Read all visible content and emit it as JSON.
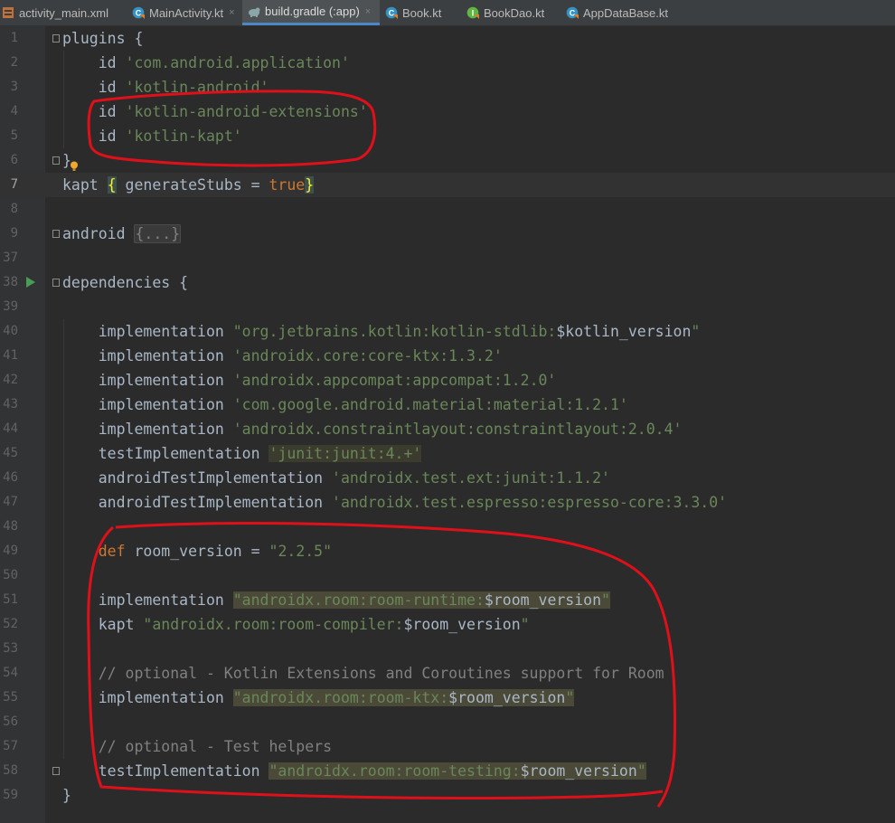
{
  "tabs": [
    {
      "label": "activity_main.xml",
      "icon": "xml-layout-icon",
      "active": false,
      "closable": false
    },
    {
      "label": "MainActivity.kt",
      "icon": "kotlin-class-icon",
      "active": false,
      "closable": true
    },
    {
      "label": "build.gradle (:app)",
      "icon": "gradle-elephant-icon",
      "active": true,
      "closable": true
    },
    {
      "label": "Book.kt",
      "icon": "kotlin-class-icon",
      "active": false,
      "closable": false
    },
    {
      "label": "BookDao.kt",
      "icon": "kotlin-interface-icon",
      "active": false,
      "closable": false
    },
    {
      "label": "AppDataBase.kt",
      "icon": "kotlin-class-icon",
      "active": false,
      "closable": false
    }
  ],
  "close_glyph": "×",
  "colors": {
    "background": "#2b2b2b",
    "keyword": "#cc7832",
    "string": "#6a8759",
    "comment": "#808080",
    "annotation_red": "#e0101a",
    "active_tab_underline": "#4a88c7"
  },
  "current_line": "7",
  "lines": [
    {
      "n": "1",
      "code": [
        {
          "t": "plugins {"
        }
      ]
    },
    {
      "n": "2",
      "code": [
        {
          "t": "    id "
        },
        {
          "t": "'com.android.application'",
          "c": "str"
        }
      ]
    },
    {
      "n": "3",
      "code": [
        {
          "t": "    id "
        },
        {
          "t": "'kotlin-android'",
          "c": "str"
        }
      ]
    },
    {
      "n": "4",
      "code": [
        {
          "t": "    id "
        },
        {
          "t": "'kotlin-android-extensions'",
          "c": "str"
        }
      ]
    },
    {
      "n": "5",
      "code": [
        {
          "t": "    id "
        },
        {
          "t": "'kotlin-kapt'",
          "c": "str"
        }
      ]
    },
    {
      "n": "6",
      "code": [
        {
          "t": "}"
        }
      ]
    },
    {
      "n": "7",
      "code": [
        {
          "t": "kapt "
        },
        {
          "t": "{",
          "c": "brace-match"
        },
        {
          "t": " generateStubs = "
        },
        {
          "t": "true",
          "c": "lit"
        },
        {
          "t": "}",
          "c": "brace-match"
        }
      ]
    },
    {
      "n": "8",
      "code": []
    },
    {
      "n": "9",
      "code": [
        {
          "t": "android "
        },
        {
          "t": "{...}",
          "c": "fold-region"
        }
      ]
    },
    {
      "n": "37",
      "code": []
    },
    {
      "n": "38",
      "code": [
        {
          "t": "dependencies {"
        }
      ]
    },
    {
      "n": "39",
      "code": []
    },
    {
      "n": "40",
      "code": [
        {
          "t": "    implementation "
        },
        {
          "t": "\"org.jetbrains.kotlin:kotlin-stdlib:",
          "c": "str"
        },
        {
          "t": "$kotlin_version"
        },
        {
          "t": "\"",
          "c": "str"
        }
      ]
    },
    {
      "n": "41",
      "code": [
        {
          "t": "    implementation "
        },
        {
          "t": "'androidx.core:core-ktx:1.3.2'",
          "c": "str"
        }
      ]
    },
    {
      "n": "42",
      "code": [
        {
          "t": "    implementation "
        },
        {
          "t": "'androidx.appcompat:appcompat:1.2.0'",
          "c": "str"
        }
      ]
    },
    {
      "n": "43",
      "code": [
        {
          "t": "    implementation "
        },
        {
          "t": "'com.google.android.material:material:1.2.1'",
          "c": "str"
        }
      ]
    },
    {
      "n": "44",
      "code": [
        {
          "t": "    implementation "
        },
        {
          "t": "'androidx.constraintlayout:constraintlayout:2.0.4'",
          "c": "str"
        }
      ]
    },
    {
      "n": "45",
      "code": [
        {
          "t": "    testImplementation "
        },
        {
          "t": "'junit:junit:4.+'",
          "c": "str hl"
        }
      ]
    },
    {
      "n": "46",
      "code": [
        {
          "t": "    androidTestImplementation "
        },
        {
          "t": "'androidx.test.ext:junit:1.1.2'",
          "c": "str"
        }
      ]
    },
    {
      "n": "47",
      "code": [
        {
          "t": "    androidTestImplementation "
        },
        {
          "t": "'androidx.test.espresso:espresso-core:3.3.0'",
          "c": "str"
        }
      ]
    },
    {
      "n": "48",
      "code": []
    },
    {
      "n": "49",
      "code": [
        {
          "t": "    "
        },
        {
          "t": "def",
          "c": "kw"
        },
        {
          "t": " room_version = "
        },
        {
          "t": "\"2.2.5\"",
          "c": "str"
        }
      ]
    },
    {
      "n": "50",
      "code": []
    },
    {
      "n": "51",
      "code": [
        {
          "t": "    implementation "
        },
        {
          "t": "\"androidx.room:room-runtime:",
          "c": "str hl2"
        },
        {
          "t": "$room_version",
          "c": "hl2"
        },
        {
          "t": "\"",
          "c": "str hl2"
        }
      ]
    },
    {
      "n": "52",
      "code": [
        {
          "t": "    kapt "
        },
        {
          "t": "\"androidx.room:room-compiler:",
          "c": "str"
        },
        {
          "t": "$room_version"
        },
        {
          "t": "\"",
          "c": "str"
        }
      ]
    },
    {
      "n": "53",
      "code": []
    },
    {
      "n": "54",
      "code": [
        {
          "t": "    // optional - Kotlin Extensions and Coroutines support for Room",
          "c": "cmt"
        }
      ]
    },
    {
      "n": "55",
      "code": [
        {
          "t": "    implementation "
        },
        {
          "t": "\"androidx.room:room-ktx:",
          "c": "str hl2"
        },
        {
          "t": "$room_version",
          "c": "hl2"
        },
        {
          "t": "\"",
          "c": "str hl2"
        }
      ]
    },
    {
      "n": "56",
      "code": []
    },
    {
      "n": "57",
      "code": [
        {
          "t": "    // optional - Test helpers",
          "c": "cmt"
        }
      ]
    },
    {
      "n": "58",
      "code": [
        {
          "t": "    testImplementation "
        },
        {
          "t": "\"androidx.room:room-testing:",
          "c": "str hl2"
        },
        {
          "t": "$room_version",
          "c": "hl2"
        },
        {
          "t": "\"",
          "c": "str hl2"
        }
      ]
    },
    {
      "n": "59",
      "code": [
        {
          "t": "}"
        }
      ]
    }
  ]
}
